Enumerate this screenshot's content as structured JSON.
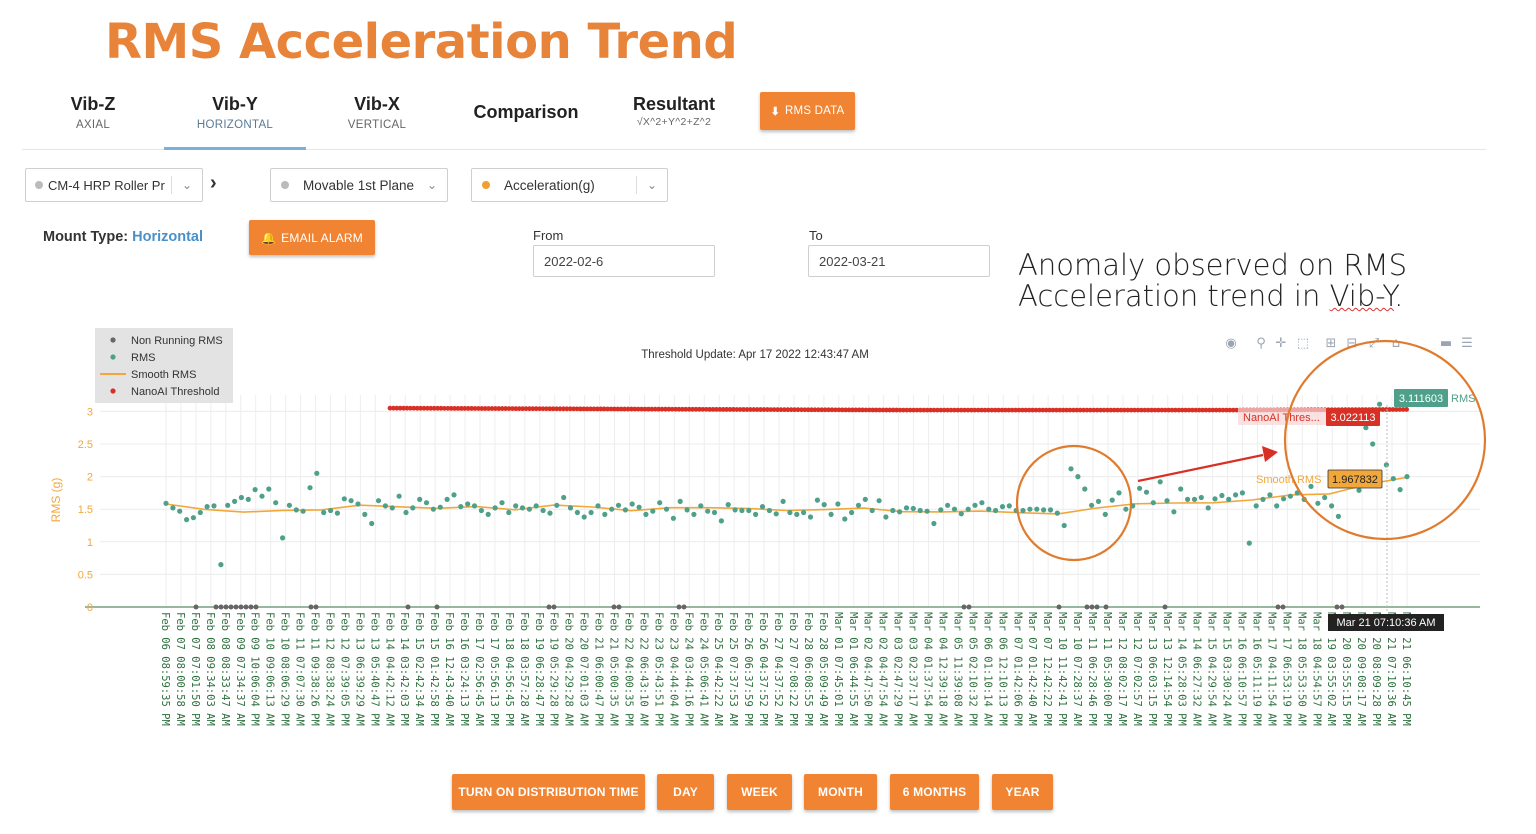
{
  "slide_title": "RMS Acceleration Trend",
  "tabs": [
    {
      "label": "Vib-Z",
      "sub": "AXIAL"
    },
    {
      "label": "Vib-Y",
      "sub": "HORIZONTAL"
    },
    {
      "label": "Vib-X",
      "sub": "VERTICAL"
    },
    {
      "label": "Comparison",
      "sub": ""
    },
    {
      "label": "Resultant",
      "sub": "√X^2+Y^2+Z^2"
    }
  ],
  "active_tab": "Vib-Y",
  "rms_data_button": "RMS DATA",
  "selectors": {
    "machine": "CM-4 HRP Roller Pr",
    "breadcrumb_arrow": "›",
    "plane": "Movable 1st Plane",
    "measure": "Acceleration(g)"
  },
  "mount": {
    "label": "Mount Type:",
    "value": "Horizontal"
  },
  "email_alarm_button": "EMAIL ALARM",
  "date_range": {
    "from_label": "From",
    "from_value": "2022-02-6",
    "to_label": "To",
    "to_value": "2022-03-21"
  },
  "annotation": {
    "line1": "Anomaly observed on RMS",
    "line2_a": "Acceleration trend in ",
    "line2_b": "Vib-Y",
    "line2_c": "."
  },
  "bottom_buttons": [
    "TURN ON DISTRIBUTION TIME",
    "DAY",
    "WEEK",
    "MONTH",
    "6 MONTHS",
    "YEAR"
  ],
  "colors": {
    "accent": "#F08432",
    "rms": "#4FA08B",
    "smooth": "#F2A73B",
    "threshold": "#D93025",
    "nonrunning": "#666666",
    "circle": "#E07B2E"
  },
  "icons": [
    "camera-icon",
    "zoom-icon",
    "pan-icon",
    "box-select-icon",
    "zoom-in-icon",
    "zoom-out-icon",
    "autoscale-icon",
    "reset-axes-icon",
    "spike-lines-icon",
    "hover-compare-icon"
  ],
  "chart_data": {
    "type": "scatter",
    "title": "Threshold Update: Apr 17 2022 12:43:47 AM",
    "ylabel": "RMS (g)",
    "ylim": [
      0,
      3.2
    ],
    "yticks": [
      0,
      0.5,
      1,
      1.5,
      2,
      2.5,
      3
    ],
    "grid": true,
    "legend_position": "top-left",
    "legend": [
      "Non Running RMS",
      "RMS",
      "Smooth RMS",
      "NanoAI Threshold"
    ],
    "x_labels": [
      "Feb 06 08:59:35 PM",
      "Feb 07 08:00:58 AM",
      "Feb 07 07:01:50 PM",
      "Feb 08 09:34:03 AM",
      "Feb 08 08:33:47 AM",
      "Feb 09 07:34:37 AM",
      "Feb 09 10:06:04 PM",
      "Feb 10 09:06:13 AM",
      "Feb 10 08:06:29 PM",
      "Feb 11 07:07:30 AM",
      "Feb 11 09:38:26 PM",
      "Feb 12 08:38:24 AM",
      "Feb 12 07:39:05 PM",
      "Feb 13 06:39:29 AM",
      "Feb 13 05:40:47 PM",
      "Feb 14 04:42:12 AM",
      "Feb 14 03:42:03 PM",
      "Feb 15 02:42:34 AM",
      "Feb 15 01:42:58 PM",
      "Feb 16 12:43:40 AM",
      "Feb 16 03:24:13 PM",
      "Feb 17 02:56:45 AM",
      "Feb 17 05:56:13 PM",
      "Feb 18 04:56:45 PM",
      "Feb 18 03:57:28 AM",
      "Feb 19 06:28:47 PM",
      "Feb 19 05:29:28 PM",
      "Feb 20 04:29:28 AM",
      "Feb 20 07:01:03 AM",
      "Feb 21 06:00:47 PM",
      "Feb 21 05:00:35 AM",
      "Feb 22 04:00:35 PM",
      "Feb 22 06:43:10 AM",
      "Feb 23 05:43:51 PM",
      "Feb 23 04:44:04 AM",
      "Feb 24 03:44:16 PM",
      "Feb 24 05:06:41 AM",
      "Feb 25 04:42:22 AM",
      "Feb 25 07:37:53 AM",
      "Feb 26 06:37:59 PM",
      "Feb 26 04:37:52 PM",
      "Feb 27 04:37:52 AM",
      "Feb 27 07:08:22 PM",
      "Feb 28 06:08:55 PM",
      "Feb 28 05:09:49 AM",
      "Mar 01 07:45:01 PM",
      "Mar 01 06:44:55 AM",
      "Mar 02 04:47:50 PM",
      "Mar 02 04:47:54 AM",
      "Mar 03 02:47:29 PM",
      "Mar 03 02:37:17 AM",
      "Mar 04 01:37:54 PM",
      "Mar 04 12:39:18 AM",
      "Mar 05 11:39:08 AM",
      "Mar 05 02:10:32 PM",
      "Mar 06 01:10:14 AM",
      "Mar 06 12:10:13 PM",
      "Mar 07 01:42:06 PM",
      "Mar 07 01:42:40 AM",
      "Mar 07 12:42:22 PM",
      "Mar 10 11:42:41 PM",
      "Mar 10 07:28:37 AM",
      "Mar 11 06:28:46 PM",
      "Mar 11 05:30:00 PM",
      "Mar 12 08:02:17 AM",
      "Mar 12 07:02:57 AM",
      "Mar 13 06:03:15 PM",
      "Mar 13 12:14:54 PM",
      "Mar 14 05:28:03 PM",
      "Mar 14 06:27:32 AM",
      "Mar 15 04:29:54 AM",
      "Mar 15 03:30:24 AM",
      "Mar 16 06:10:57 PM",
      "Mar 16 05:11:19 PM",
      "Mar 17 04:11:54 AM",
      "Mar 17 06:53:19 PM",
      "Mar 18 05:53:50 AM",
      "Mar 18 04:54:57 PM",
      "Mar 19 03:55:02 AM",
      "Mar 20 03:55:15 PM",
      "Mar 20 09:08:17 AM",
      "Mar 20 08:09:28 PM",
      "Mar 21 07:10:36 AM",
      "Mar 21 06:10:45 PM"
    ],
    "series": [
      {
        "name": "RMS",
        "type": "scatter",
        "values": [
          1.59,
          1.52,
          1.47,
          1.34,
          1.37,
          1.45,
          1.54,
          1.55,
          0.65,
          1.56,
          1.62,
          1.68,
          1.65,
          1.8,
          1.7,
          1.81,
          1.6,
          1.06,
          1.56,
          1.49,
          1.47,
          1.83,
          2.05,
          1.45,
          1.48,
          1.44,
          1.66,
          1.63,
          1.58,
          1.42,
          1.28,
          1.63,
          1.55,
          1.52,
          1.7,
          1.45,
          1.52,
          1.65,
          1.6,
          1.5,
          1.53,
          1.65,
          1.72,
          1.54,
          1.58,
          1.55,
          1.48,
          1.42,
          1.52,
          1.6,
          1.45,
          1.55,
          1.52,
          1.5,
          1.55,
          1.48,
          1.44,
          1.56,
          1.68,
          1.52,
          1.45,
          1.38,
          1.45,
          1.55,
          1.42,
          1.5,
          1.56,
          1.49,
          1.58,
          1.53,
          1.42,
          1.47,
          1.6,
          1.5,
          1.36,
          1.62,
          1.49,
          1.42,
          1.55,
          1.47,
          1.45,
          1.32,
          1.57,
          1.49,
          1.48,
          1.48,
          1.42,
          1.54,
          1.48,
          1.43,
          1.62,
          1.45,
          1.42,
          1.45,
          1.38,
          1.64,
          1.57,
          1.42,
          1.58,
          1.35,
          1.45,
          1.56,
          1.65,
          1.48,
          1.63,
          1.38,
          1.48,
          1.46,
          1.52,
          1.51,
          1.48,
          1.47,
          1.28,
          1.49,
          1.56,
          1.5,
          1.43,
          1.5,
          1.56,
          1.6,
          1.5,
          1.48,
          1.54,
          1.55,
          1.48,
          1.48,
          1.5,
          1.5,
          1.49,
          1.49,
          1.44,
          1.25,
          2.12,
          2.0,
          1.81,
          1.56,
          1.62,
          1.42,
          1.64,
          1.75,
          1.5,
          1.55,
          1.82,
          1.76,
          1.6,
          1.92,
          1.63,
          1.46,
          1.81,
          1.65,
          1.65,
          1.68,
          1.52,
          1.66,
          1.71,
          1.65,
          1.72,
          1.75,
          0.98,
          1.55,
          1.65,
          1.72,
          1.55,
          1.66,
          1.7,
          1.75,
          1.65,
          1.85,
          1.59,
          1.68,
          1.55,
          1.39,
          1.93,
          1.91,
          1.79,
          2.75,
          2.5,
          3.11,
          2.18,
          1.97,
          1.8,
          2.0
        ]
      },
      {
        "name": "Smooth RMS",
        "type": "line",
        "values": [
          1.58,
          1.52,
          1.45,
          1.46,
          1.5,
          1.58,
          1.52,
          1.5,
          1.56,
          1.5,
          1.54,
          1.53,
          1.5,
          1.52,
          1.5,
          1.52,
          1.5,
          1.48,
          1.5,
          1.48,
          1.47,
          1.45,
          1.44,
          1.45,
          1.52,
          1.56,
          1.6,
          1.62,
          1.63,
          1.7,
          1.75,
          1.9,
          1.97
        ]
      },
      {
        "name": "NanoAI Threshold",
        "type": "scatter",
        "values": [
          3.05,
          3.04,
          3.03,
          3.02,
          3.02,
          3.02,
          3.03
        ]
      },
      {
        "name": "Non Running RMS",
        "type": "scatter",
        "values": [
          0,
          0,
          0,
          0,
          0,
          0,
          0,
          0,
          0,
          0,
          0,
          0,
          0,
          0,
          0,
          0,
          0,
          0,
          0,
          0,
          0,
          0,
          0,
          0,
          0,
          0,
          0
        ]
      }
    ],
    "hover_labels": {
      "rms": "3.111603",
      "rms_name": "RMS",
      "threshold": "3.022113",
      "threshold_name": "NanoAI Thres...",
      "smooth": "1.967832",
      "smooth_name": "Smooth RMS",
      "x": "Mar 21  07:10:36 AM"
    }
  }
}
